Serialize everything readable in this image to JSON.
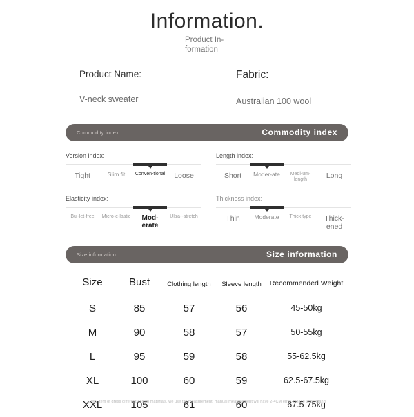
{
  "header": {
    "title": "Information.",
    "subtitle": "Product In-formation"
  },
  "product": {
    "name_label": "Product Name:",
    "name_value": "V-neck sweater",
    "fabric_label": "Fabric:",
    "fabric_value": "Australian 100 wool"
  },
  "commodity_section": {
    "bar_left": "Commodity index:",
    "bar_right": "Commodity index"
  },
  "indexes": [
    {
      "title": "Version index:",
      "selected": 3,
      "ticks": [
        {
          "label": "Tight",
          "size": "lg"
        },
        {
          "label": "Slim fit",
          "size": "md"
        },
        {
          "label": "Conven-tional",
          "size": "sel-sm"
        },
        {
          "label": "Loose",
          "size": "lg"
        }
      ]
    },
    {
      "title": "Length index:",
      "selected": 2,
      "ticks": [
        {
          "label": "Short",
          "size": "lg"
        },
        {
          "label": "Moder-ate",
          "size": "md"
        },
        {
          "label": "Medi-um-length",
          "size": "sm"
        },
        {
          "label": "Long",
          "size": "lg"
        }
      ]
    },
    {
      "title": "Elasticity index:",
      "selected": 3,
      "ticks": [
        {
          "label": "Bul-let-free",
          "size": "sm"
        },
        {
          "label": "Micro-e-lastic",
          "size": "sm"
        },
        {
          "label": "Mod-erate",
          "size": "sel"
        },
        {
          "label": "Ultra--stretch",
          "size": "sm"
        }
      ]
    },
    {
      "title": "Thickness index:",
      "selected": 2,
      "ticks": [
        {
          "label": "Thin",
          "size": "lg"
        },
        {
          "label": "Moderate",
          "size": "md"
        },
        {
          "label": "Thick type",
          "size": "sm"
        },
        {
          "label": "Thick-ened",
          "size": "lg"
        }
      ]
    }
  ],
  "size_section": {
    "bar_left": "Size information:",
    "bar_right": "Size information"
  },
  "size_table": {
    "columns": [
      "Size",
      "Bust",
      "Clothing length",
      "Sleeve length",
      "Recommended Weight"
    ],
    "rows": [
      {
        "size": "S",
        "bust": "85",
        "clothing": "57",
        "sleeve": "56",
        "weight": "45-50kg"
      },
      {
        "size": "M",
        "bust": "90",
        "clothing": "58",
        "sleeve": "57",
        "weight": "50-55kg"
      },
      {
        "size": "L",
        "bust": "95",
        "clothing": "59",
        "sleeve": "58",
        "weight": "55-62.5kg"
      },
      {
        "size": "XL",
        "bust": "100",
        "clothing": "60",
        "sleeve": "59",
        "weight": "62.5-67.5kg"
      },
      {
        "size": "XXL",
        "bust": "105",
        "clothing": "61",
        "sleeve": "60",
        "weight": "67.5-75kg"
      }
    ]
  },
  "footer": {
    "note": "Every item of dress different design materials, we use tile measurement, manual measurement will have 2-4CM error, please understand."
  },
  "colors": {
    "bar": "#696462",
    "track": "#e4e4e4",
    "track_fill": "#2f2f2f"
  }
}
